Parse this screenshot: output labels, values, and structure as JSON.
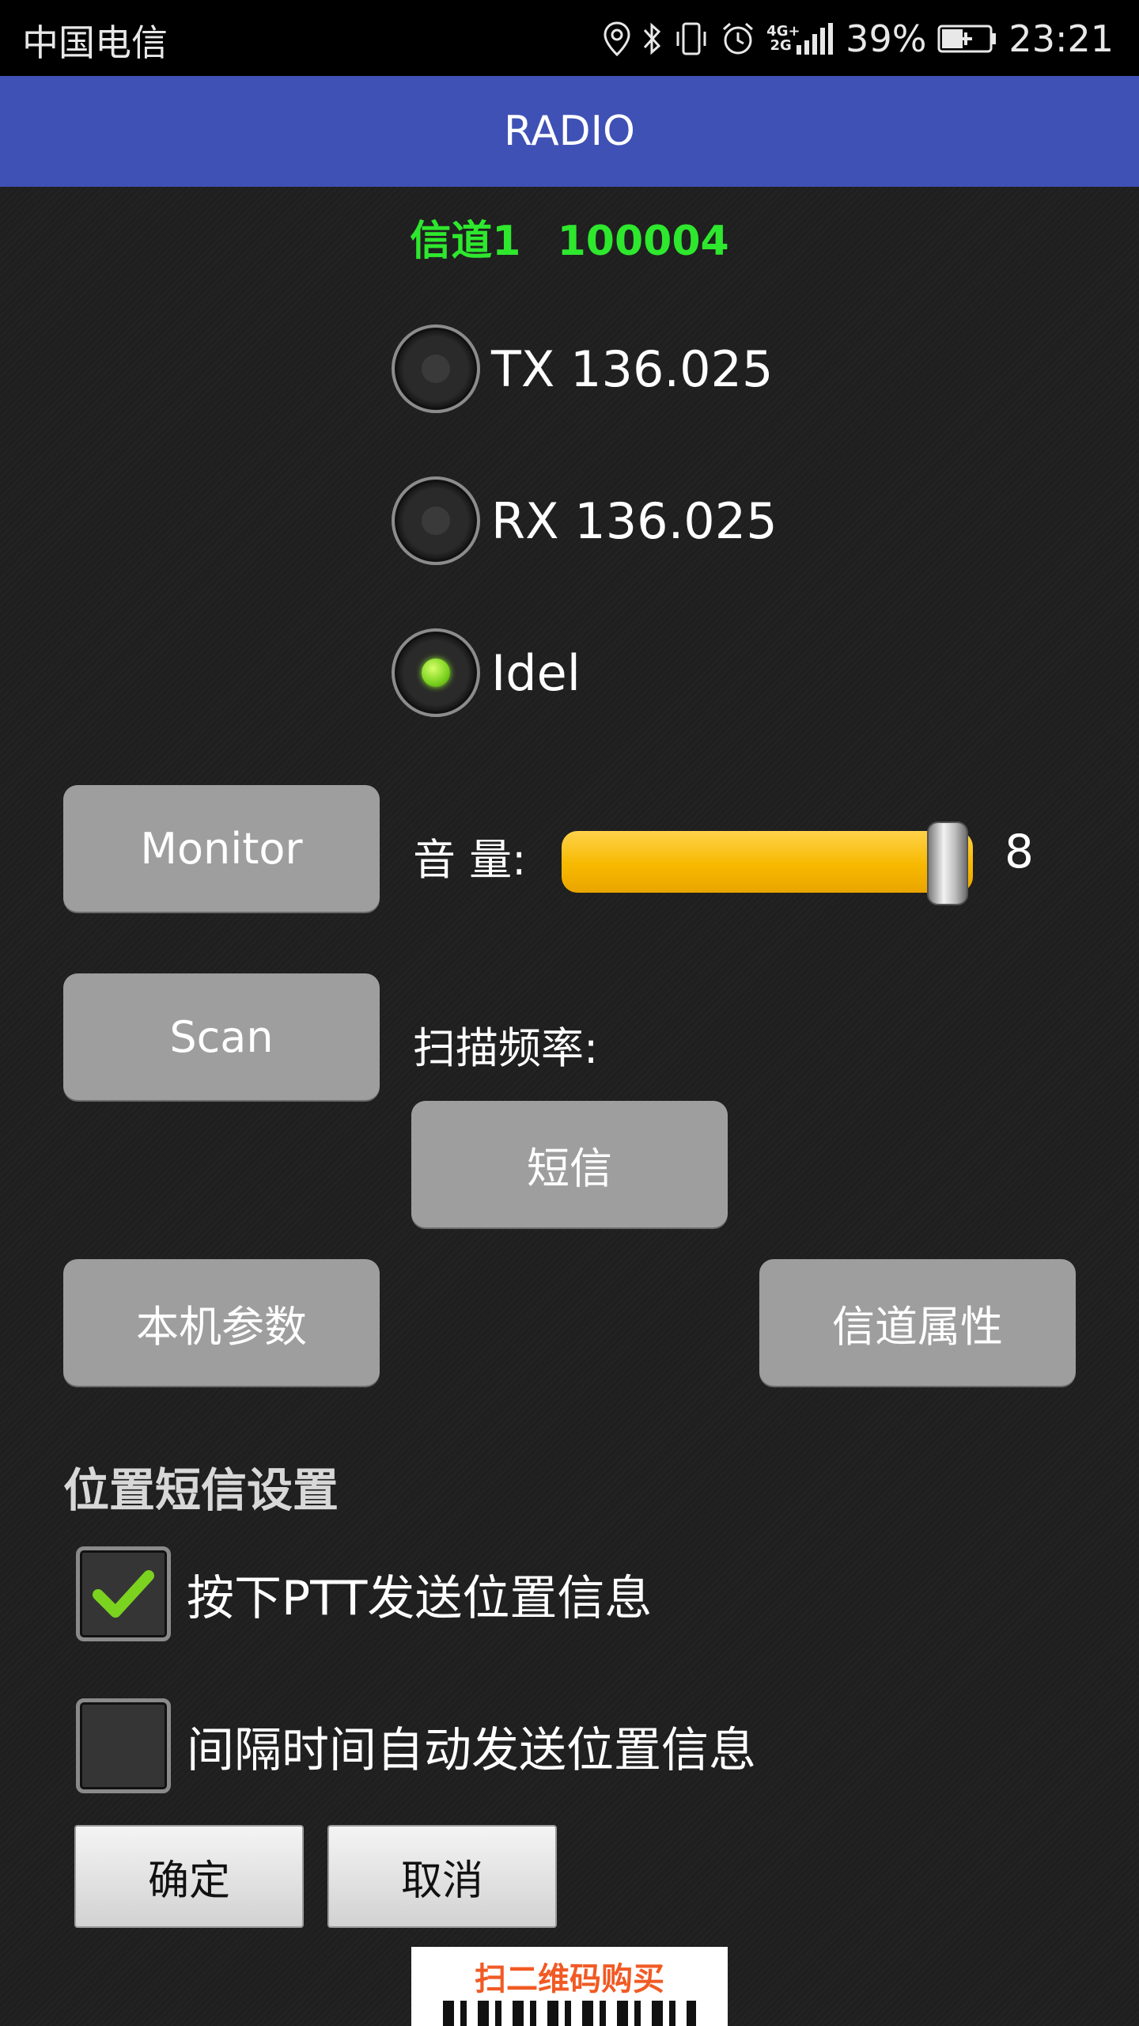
{
  "status_bar": {
    "carrier": "中国电信",
    "network": "4G+ 2G",
    "battery_percent": "39%",
    "time": "23:21",
    "icons": [
      "location-icon",
      "bluetooth-icon",
      "vibrate-icon",
      "alarm-icon",
      "signal-icon",
      "battery-icon"
    ]
  },
  "app_bar": {
    "title": "RADIO"
  },
  "channel": {
    "name": "信道1",
    "number": "100004"
  },
  "radios": [
    {
      "label": "TX 136.025",
      "selected": false
    },
    {
      "label": "RX 136.025",
      "selected": false
    },
    {
      "label": "Idel",
      "selected": true
    }
  ],
  "controls": {
    "monitor_label": "Monitor",
    "volume_label": "音 量:",
    "volume_value": "8",
    "volume_level": 8,
    "scan_label": "Scan",
    "scan_freq_label": "扫描频率:",
    "sms_label": "短信",
    "local_params_label": "本机参数",
    "channel_props_label": "信道属性"
  },
  "location_sms": {
    "section_title": "位置短信设置",
    "option_ptt": {
      "label": "按下PTT发送位置信息",
      "checked": true
    },
    "option_interval": {
      "label": "间隔时间自动发送位置信息",
      "checked": false
    },
    "confirm_label": "确定",
    "cancel_label": "取消"
  },
  "ad": {
    "text": "扫二维码购买"
  },
  "colors": {
    "app_bar": "#3f51b5",
    "channel_text": "#2ee82e",
    "slider": "#f7b900",
    "button": "#9e9e9e",
    "background": "#1f1f1f"
  }
}
